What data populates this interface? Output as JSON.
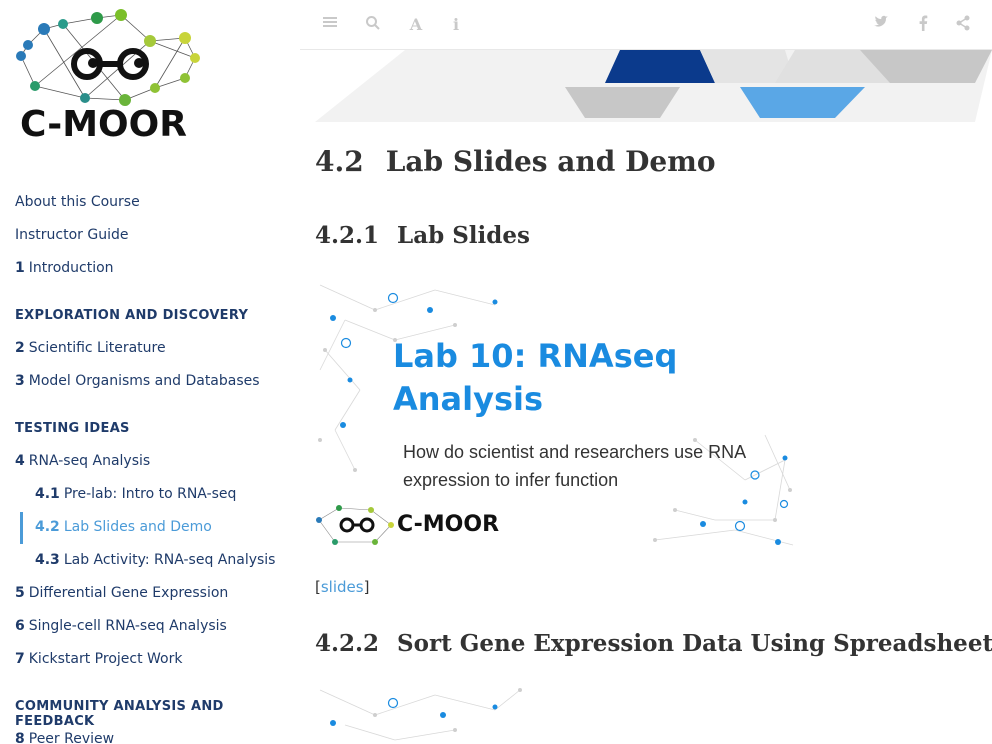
{
  "sidebar": {
    "logo_text": "C-MOOR",
    "toc": {
      "about": "About this Course",
      "instructor": "Instructor Guide",
      "ch1_num": "1",
      "ch1": "Introduction",
      "part1": "EXPLORATION AND DISCOVERY",
      "ch2_num": "2",
      "ch2": "Scientific Literature",
      "ch3_num": "3",
      "ch3": "Model Organisms and Databases",
      "part2": "TESTING IDEAS",
      "ch4_num": "4",
      "ch4": "RNA-seq Analysis",
      "s41_num": "4.1",
      "s41": "Pre-lab: Intro to RNA-seq",
      "s42_num": "4.2",
      "s42": "Lab Slides and Demo",
      "s43_num": "4.3",
      "s43": "Lab Activity: RNA-seq Analysis",
      "ch5_num": "5",
      "ch5": "Differential Gene Expression",
      "ch6_num": "6",
      "ch6": "Single-cell RNA-seq Analysis",
      "ch7_num": "7",
      "ch7": "Kickstart Project Work",
      "part3": "COMMUNITY ANALYSIS AND FEEDBACK",
      "ch8_num": "8",
      "ch8": "Peer Review"
    }
  },
  "toolbar": {
    "icons": [
      "menu-icon",
      "search-icon",
      "font-icon",
      "info-icon",
      "twitter-icon",
      "facebook-icon",
      "share-icon"
    ]
  },
  "main": {
    "h2_num": "4.2",
    "h2": "Lab Slides and Demo",
    "h3a_num": "4.2.1",
    "h3a": "Lab Slides",
    "slide_title": "Lab 10: RNAseq Analysis",
    "slide_subtitle": "How do scientist and researchers use RNA expression to infer function",
    "slide_brand": "C-MOOR",
    "link_open": "[",
    "link_text": "slides",
    "link_close": "]",
    "h3b_num": "4.2.2",
    "h3b": "Sort Gene Expression Data Using Spreadsheets"
  },
  "colors": {
    "nav": "#1f3b6a",
    "accent": "#4b9bd8",
    "slide_title": "#1a8be0",
    "banner_dark": "#0b3a8c",
    "banner_light": "#5aa7e6"
  }
}
